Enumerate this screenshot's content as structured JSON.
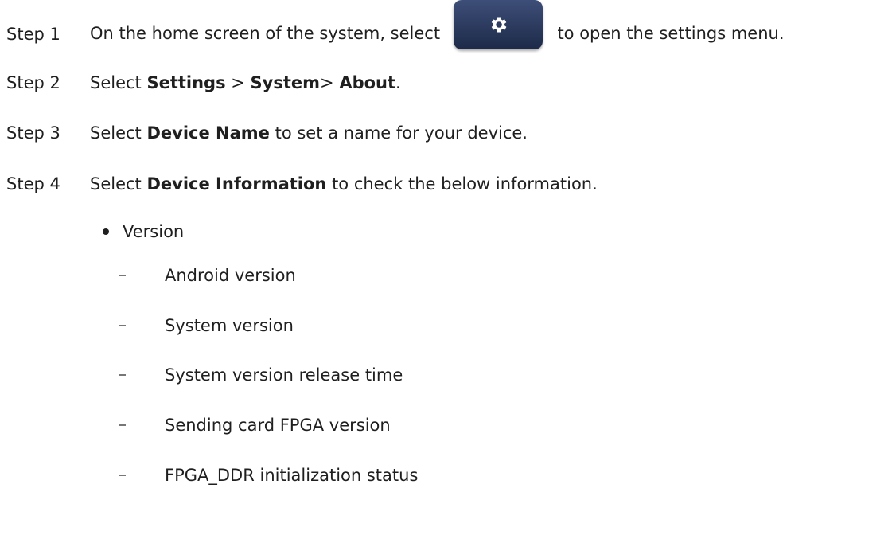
{
  "steps": [
    {
      "label": "Step 1",
      "before": "On the home screen of the system, select",
      "after": "to open the settings menu.",
      "icon": "gear-icon"
    },
    {
      "label": "Step 2",
      "parts": [
        "Select ",
        "Settings",
        " > ",
        "System",
        "> ",
        "About",
        "."
      ]
    },
    {
      "label": "Step 3",
      "parts": [
        "Select ",
        "Device Name",
        " to set a name for your device."
      ]
    },
    {
      "label": "Step 4",
      "parts": [
        "Select ",
        "Device Information",
        " to check the below information."
      ]
    }
  ],
  "bullet": {
    "label": "Version"
  },
  "subitems": [
    "Android version",
    "System version",
    "System version release time",
    "Sending card FPGA version",
    "FPGA_DDR initialization status"
  ],
  "colors": {
    "text": "#1f1f1f",
    "button": "#2b3a5e",
    "icon": "#ffffff"
  }
}
